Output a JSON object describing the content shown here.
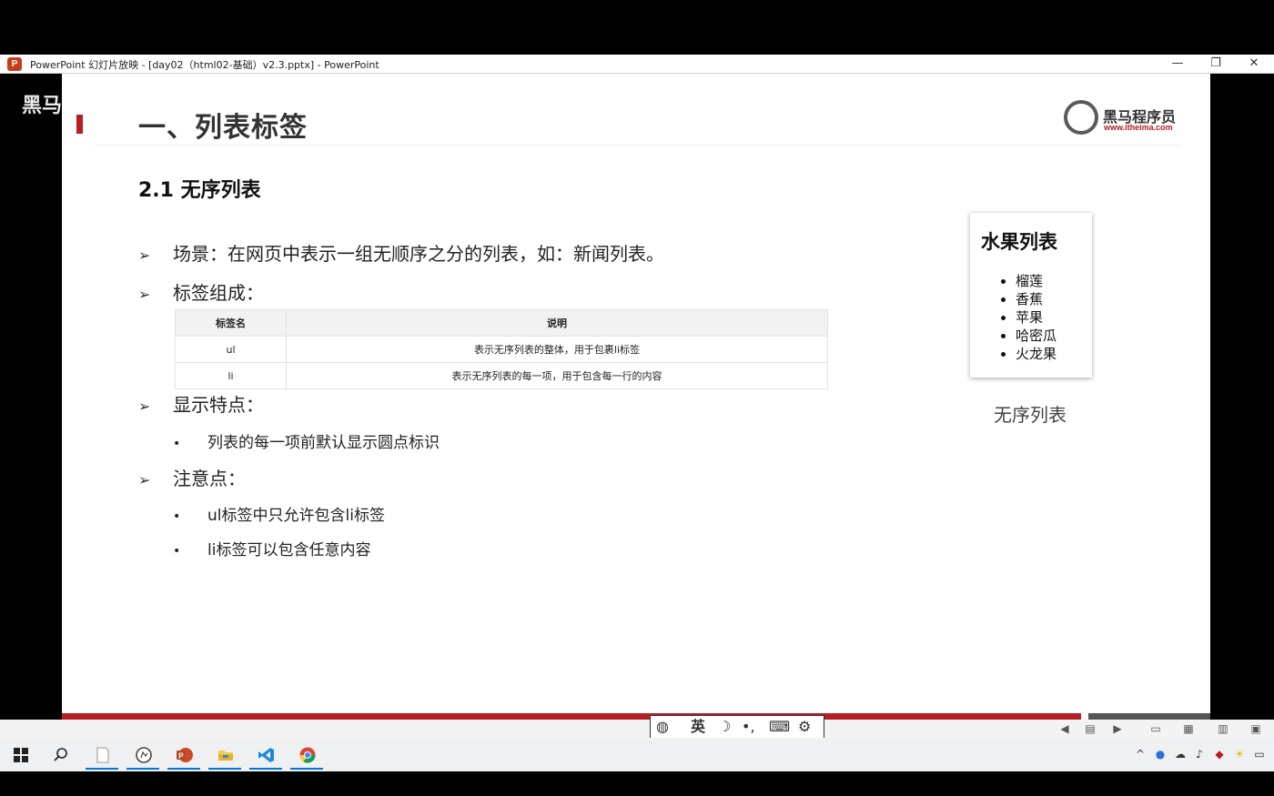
{
  "window": {
    "title": "PowerPoint 幻灯片放映 - [day02（html02-基础）v2.3.pptx] - PowerPoint",
    "app_icon_letter": "P",
    "minimize": "—",
    "restore": "❐",
    "close": "✕"
  },
  "slide": {
    "watermark": "黑马",
    "title": "一、列表标签",
    "logo": {
      "name": "黑马程序员",
      "url": "www.itheima.com"
    },
    "subtitle": "2.1 无序列表",
    "arrow_glyph": "➢",
    "dot_glyph": "•",
    "bullets": {
      "scene": "场景：在网页中表示一组无顺序之分的列表，如：新闻列表。",
      "composition": "标签组成：",
      "features": "显示特点：",
      "features_sub": "列表的每一项前默认显示圆点标识",
      "notes": "注意点：",
      "notes_sub1": "ul标签中只允许包含li标签",
      "notes_sub2": "li标签可以包含任意内容"
    },
    "table": {
      "headers": [
        "标签名",
        "说明"
      ],
      "rows": [
        [
          "ul",
          "表示无序列表的整体，用于包裹li标签"
        ],
        [
          "li",
          "表示无序列表的每一项，用于包含每一行的内容"
        ]
      ]
    },
    "example": {
      "title": "水果列表",
      "items": [
        "榴莲",
        "香蕉",
        "苹果",
        "哈密瓜",
        "火龙果"
      ],
      "caption": "无序列表"
    }
  },
  "ime_toolbar": {
    "language": "英",
    "items": [
      "logo-icon",
      "英",
      "moon-icon",
      "punctuation-icon",
      "keyboard-icon",
      "gear-icon"
    ]
  },
  "colors": {
    "accent_red": "#b41e24",
    "taskbar_bg": "#eef0f2",
    "highlight_blue": "#0078d4"
  }
}
